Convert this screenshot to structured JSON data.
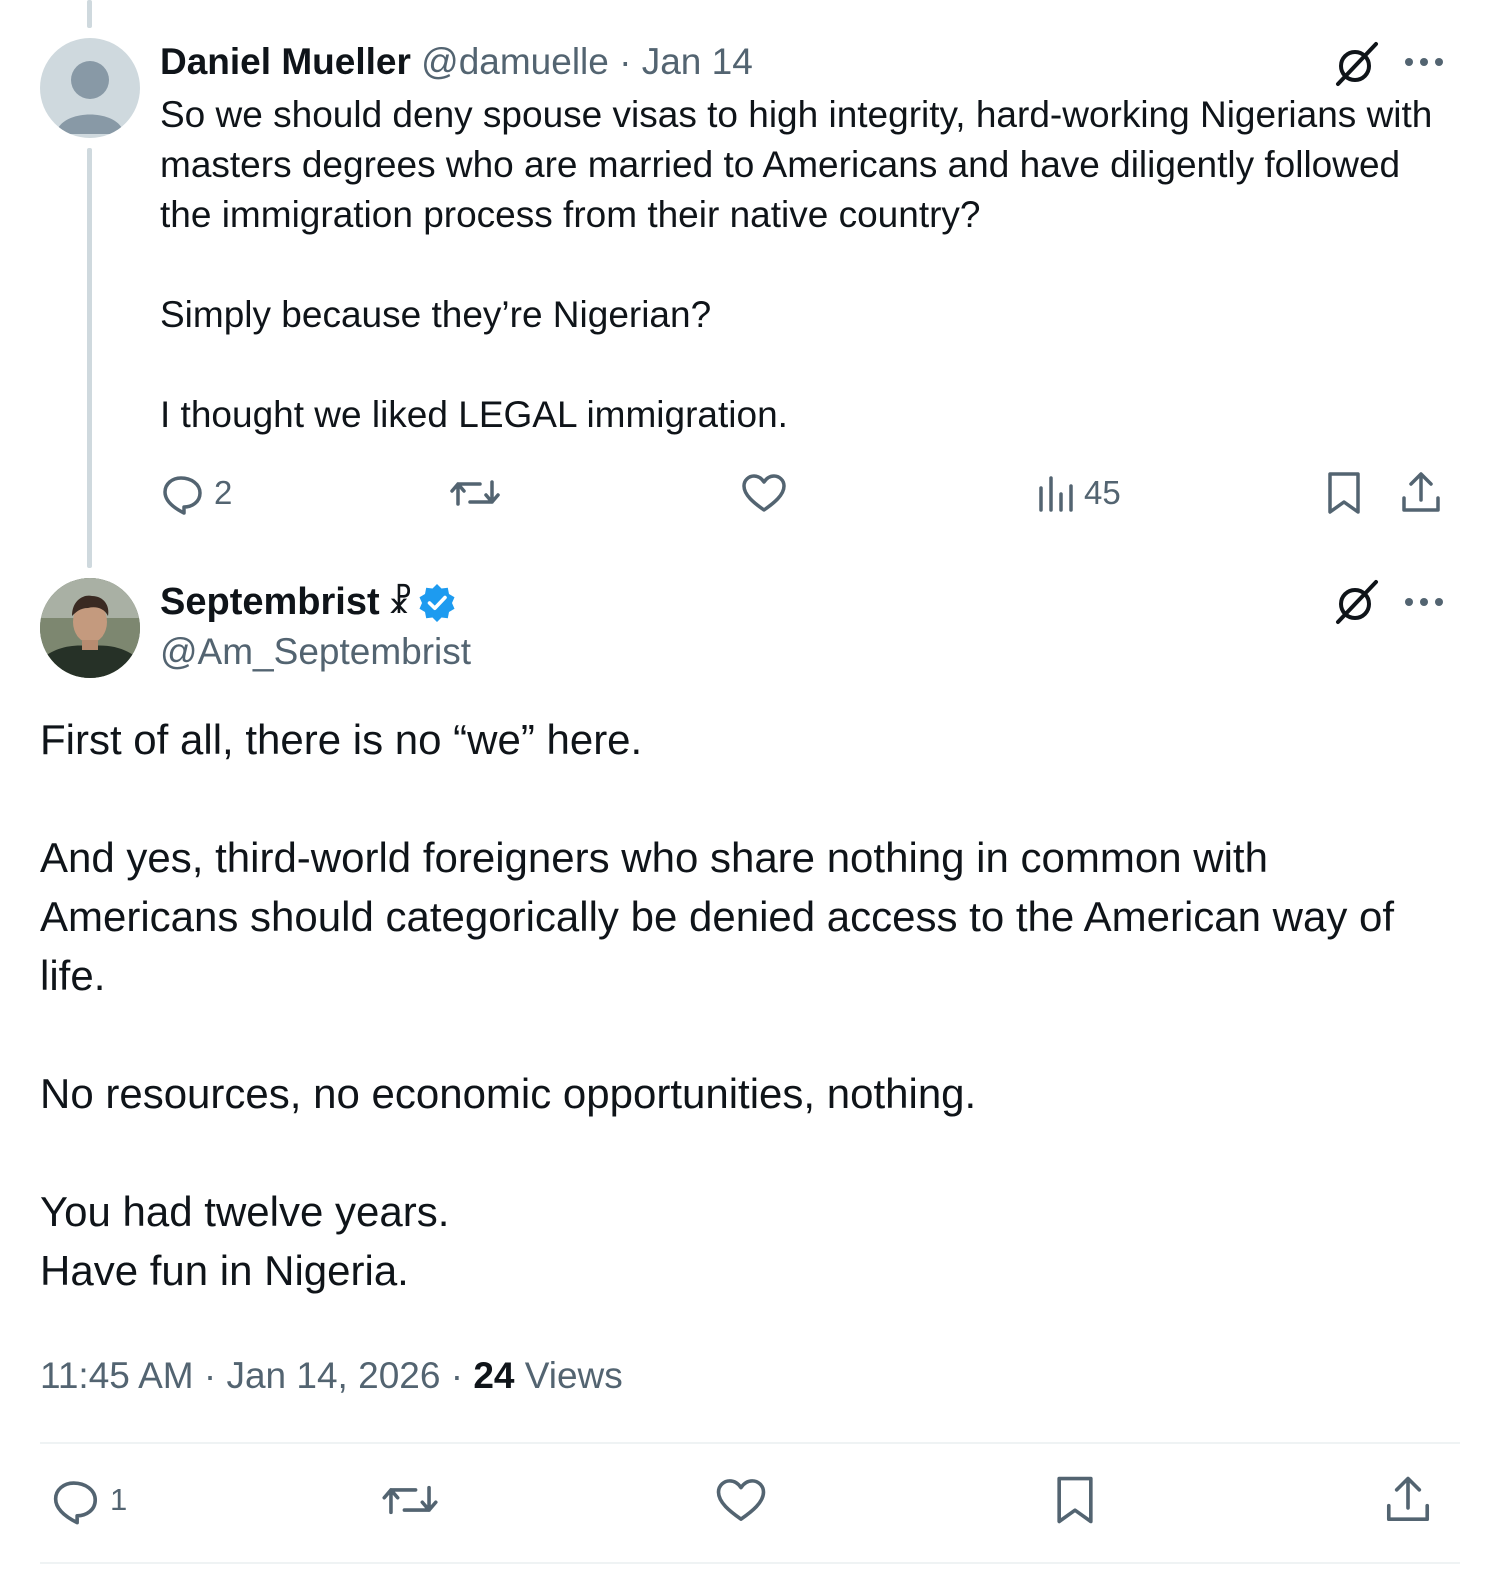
{
  "parent_post": {
    "author_name": "Daniel Mueller",
    "handle_date": "@damuelle · Jan 14",
    "text": "So we should deny spouse visas to high integrity, hard-working Nigerians with masters degrees who are married to Americans and have diligently followed the immigration process from their native country?\n\nSimply because they’re Nigerian?\n\nI thought we liked LEGAL immigration.",
    "actions": {
      "replies": "2",
      "views": "45"
    }
  },
  "main_post": {
    "author_name": "Septembrist",
    "author_badge": "☧",
    "handle": "@Am_Septembrist",
    "text": "First of all, there is no “we” here.\n\nAnd yes, third-world foreigners who share nothing in common with Americans should categorically be denied access to the American way of life.\n\nNo resources,  no economic opportunities, nothing.\n\nYou had twelve years.\nHave fun in Nigeria.",
    "timestamp": "11:45 AM · Jan 14, 2026 · ",
    "views_count": "24",
    "views_label": " Views",
    "actions": {
      "replies": "1"
    }
  },
  "colors": {
    "text": "#0f1419",
    "secondary": "#536471",
    "verified": "#1d9bf0",
    "divider": "#eff3f4"
  }
}
